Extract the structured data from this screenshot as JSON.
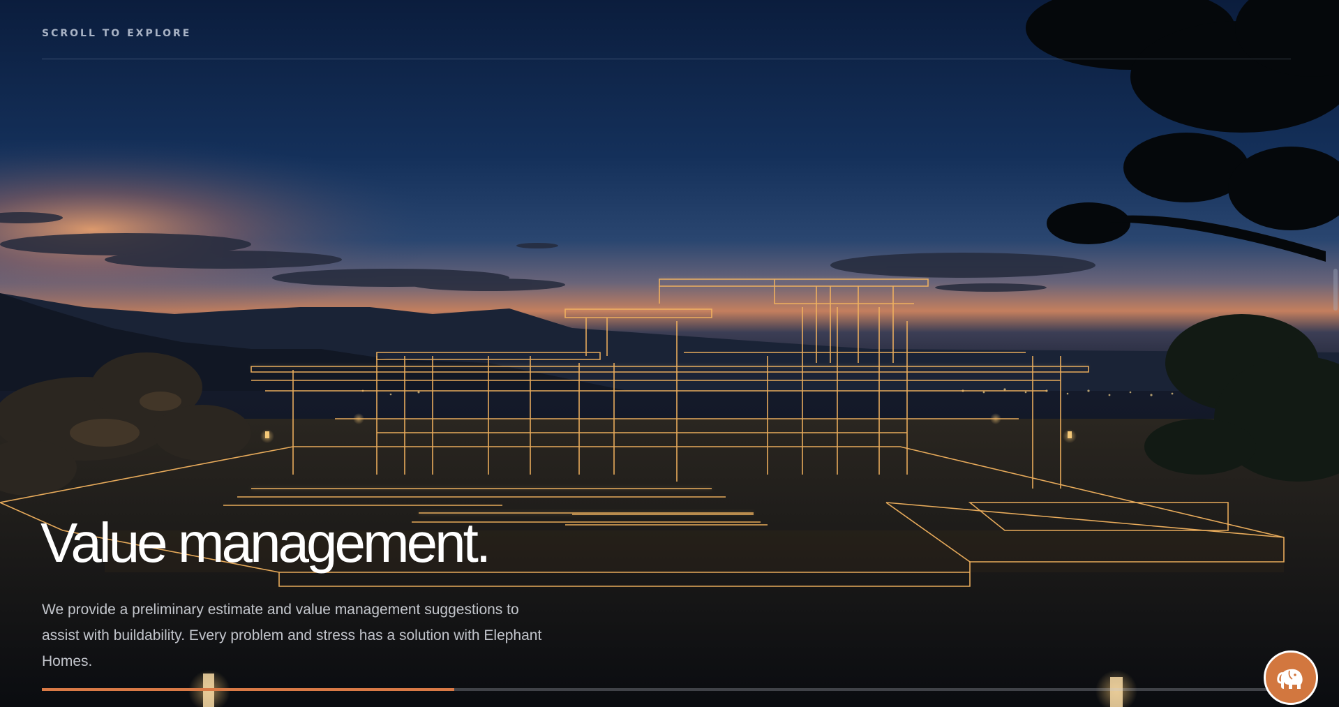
{
  "hero": {
    "scroll_label": "SCROLL TO EXPLORE",
    "headline": "Value management.",
    "description": "We provide a preliminary estimate and value management suggestions to assist with buildability. Every problem and stress has a solution with Elephant Homes.",
    "progress_percent": 33
  },
  "icons": {
    "logo": "elephant-icon"
  },
  "colors": {
    "accent": "#d97a46",
    "logo_bg": "#d2773f",
    "wireframe": "#f3b35f"
  }
}
